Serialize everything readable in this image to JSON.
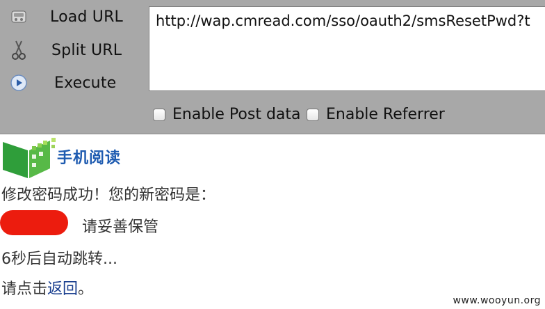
{
  "toolbar": {
    "load_url_label": "Load URL",
    "split_url_label": "Split URL",
    "execute_label": "Execute",
    "url_value": "http://wap.cmread.com/sso/oauth2/smsResetPwd?t",
    "enable_post_label": "Enable Post data",
    "enable_referrer_label": "Enable Referrer",
    "icons": {
      "load": "load-url-icon",
      "split": "scissors-icon",
      "execute": "play-icon"
    }
  },
  "page": {
    "logo_text": "手机阅读",
    "success_message": "修改密码成功！您的新密码是：",
    "keep_safe": "请妥善保管",
    "redirect_notice": "6秒后自动跳转...",
    "click_prefix": "请点击",
    "back_link": "返回",
    "click_suffix": "。",
    "redaction_color": "#ec1c0e",
    "brand_color": "#1e5bb0"
  },
  "watermark": "www.wooyun.org"
}
